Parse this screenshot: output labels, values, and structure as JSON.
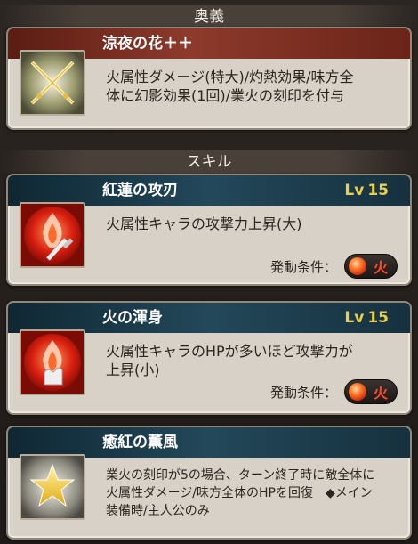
{
  "sections": {
    "ougi_title": "奥義",
    "skill_title": "スキル"
  },
  "ougi": {
    "name": "涼夜の花＋＋",
    "description_line1": "火属性ダメージ(特大)/灼熱効果/味方全",
    "description_line2": "体に幻影効果(1回)/業火の刻印を付与",
    "icon": "crossed-blades-icon"
  },
  "skills": [
    {
      "name": "紅蓮の攻刃",
      "level_prefix": "Lv",
      "level": "15",
      "description_line1": "火属性キャラの攻撃力上昇(大)",
      "description_line2": "",
      "condition_label": "発動条件：",
      "element": "火",
      "icon": "fire-sword-icon"
    },
    {
      "name": "火の渾身",
      "level_prefix": "Lv",
      "level": "15",
      "description_line1": "火属性キャラのHPが多いほど攻撃力が",
      "description_line2": "上昇(小)",
      "condition_label": "発動条件：",
      "element": "火",
      "icon": "fire-fist-icon"
    },
    {
      "name": "癒紅の薫風",
      "description_line1": "業火の刻印が5の場合、ターン終了時に敵全体に",
      "description_line2": "火属性ダメージ/味方全体のHPを回復　◆メイン",
      "description_line3": "装備時/主人公のみ",
      "icon": "star-icon"
    }
  ],
  "colors": {
    "ougi_header": "#8d3a2c",
    "skill_header": "#23485a",
    "level_text": "#e9cf4a",
    "element_fire": "#ff4a2a"
  }
}
